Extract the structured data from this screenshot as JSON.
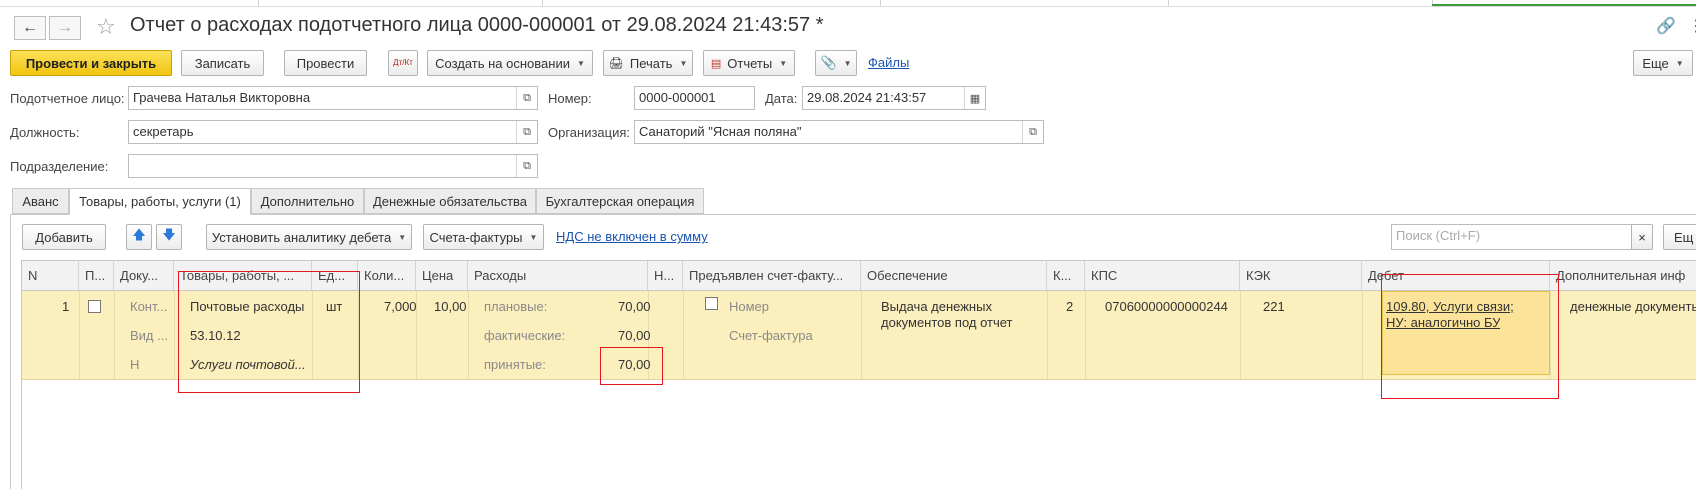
{
  "window": {
    "title": "Отчет о расходах подотчетного лица 0000-000001 от 29.08.2024 21:43:57 *"
  },
  "toolbar": {
    "post_close": "Провести и закрыть",
    "save": "Записать",
    "post": "Провести",
    "dt_kt": "Дт/Кт",
    "create_based": "Создать на основании",
    "print": "Печать",
    "reports": "Отчеты",
    "files": "Файлы",
    "more": "Еще"
  },
  "form": {
    "person_label": "Подотчетное лицо:",
    "person_value": "Грачева Наталья Викторовна",
    "number_label": "Номер:",
    "number_value": "0000-000001",
    "date_label": "Дата:",
    "date_value": "29.08.2024 21:43:57",
    "position_label": "Должность:",
    "position_value": "секретарь",
    "org_label": "Организация:",
    "org_value": "Санаторий \"Ясная поляна\"",
    "dept_label": "Подразделение:",
    "dept_value": ""
  },
  "tabs": [
    "Аванс",
    "Товары, работы, услуги (1)",
    "Дополнительно",
    "Денежные обязательства",
    "Бухгалтерская операция"
  ],
  "table_toolbar": {
    "add": "Добавить",
    "set_analytics": "Установить аналитику дебета",
    "invoices": "Счета-фактуры",
    "vat_link": "НДС не включен в сумму",
    "search_placeholder": "Поиск (Ctrl+F)",
    "more": "Ещ"
  },
  "table": {
    "columns": [
      "N",
      "П...",
      "Доку...",
      "Товары, работы, ...",
      "Ед...",
      "Коли...",
      "Цена",
      "Расходы",
      "Н...",
      "Предъявлен счет-факту...",
      "Обеспечение",
      "К...",
      "КПС",
      "КЭК",
      "Дебет",
      "Дополнительная инф"
    ],
    "row": {
      "n": "1",
      "doc1": "Конт...",
      "doc2": "Вид ...",
      "doc3": "Н",
      "goods1": "Почтовые расходы",
      "goods2": "53.10.12",
      "goods3": "Услуги почтовой...",
      "unit": "шт",
      "qty": "7,000",
      "price": "10,00",
      "exp_planned_label": "плановые:",
      "exp_planned": "70,00",
      "exp_actual_label": "фактические:",
      "exp_actual": "70,00",
      "exp_accepted_label": "принятые:",
      "exp_accepted": "70,00",
      "invoice_number": "Номер",
      "invoice_doc": "Счет-фактура",
      "provision": "Выдача денежных документов под отчет",
      "k": "2",
      "kps": "07060000000000244",
      "kek": "221",
      "debit_line1": "109.80, Услуги связи;",
      "debit_line2": "НУ: аналогично БУ",
      "additional": "денежные документы"
    }
  }
}
